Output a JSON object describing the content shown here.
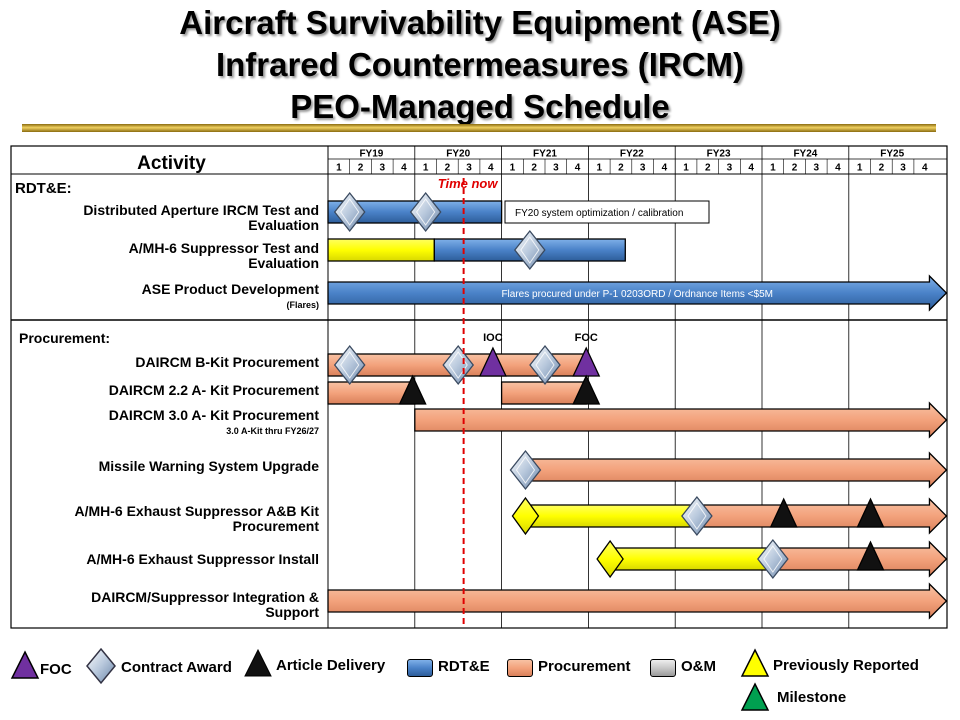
{
  "title": {
    "line1": "Aircraft Survivability Equipment (ASE)",
    "line2": "Infrared Countermeasures (IRCM)",
    "line3": "PEO-Managed Schedule"
  },
  "header": {
    "activity_label": "Activity",
    "fiscal_years": [
      "FY19",
      "FY20",
      "FY21",
      "FY22",
      "FY23",
      "FY24",
      "FY25"
    ],
    "quarters": [
      "1",
      "2",
      "3",
      "4"
    ]
  },
  "time_now_label": "Time now",
  "time_now_quarter": 6.25,
  "colors": {
    "rdte": "#4a82c8",
    "procurement": "#f3a27c",
    "om": "#c8c8c8",
    "previously_reported": "#ffff00",
    "foc": "#7030a0",
    "milestone": "#00a050",
    "time_now": "#e00000"
  },
  "sections": [
    {
      "label": "RDT&E:",
      "activities": [
        {
          "name": [
            "Distributed Aperture IRCM Test and",
            "Evaluation"
          ],
          "bars": [
            {
              "type": "rdte",
              "start": 0,
              "end": 8
            }
          ],
          "callout": "FY20 system optimization / calibration",
          "markers": [
            {
              "type": "contract-award",
              "q": 1
            },
            {
              "type": "contract-award",
              "q": 4.5
            }
          ]
        },
        {
          "name": [
            "A/MH-6 Suppressor Test and",
            "Evaluation"
          ],
          "bars": [
            {
              "type": "previously-reported",
              "start": 0,
              "end": 4.9
            },
            {
              "type": "rdte",
              "start": 4.9,
              "end": 13.7
            }
          ],
          "markers": [
            {
              "type": "contract-award",
              "q": 9.3
            }
          ]
        },
        {
          "name": [
            "ASE Product Development"
          ],
          "sub": "(Flares)",
          "bars": [
            {
              "type": "rdte",
              "start": 0,
              "end": 28.5,
              "arrow": true
            }
          ],
          "bar_text": "Flares procured under P-1 0203ORD / Ordnance Items <$5M",
          "markers": []
        }
      ]
    },
    {
      "label": "Procurement:",
      "activities": [
        {
          "name": [
            "DAIRCM B-Kit Procurement"
          ],
          "bars": [
            {
              "type": "procurement",
              "start": 0,
              "end": 12
            }
          ],
          "markers": [
            {
              "type": "contract-award",
              "q": 1
            },
            {
              "type": "contract-award",
              "q": 6
            },
            {
              "type": "foc",
              "q": 7.6,
              "label": "IOC"
            },
            {
              "type": "contract-award",
              "q": 10
            },
            {
              "type": "foc",
              "q": 11.9,
              "label": "FOC"
            }
          ]
        },
        {
          "name": [
            "DAIRCM 2.2 A- Kit Procurement"
          ],
          "bars": [
            {
              "type": "procurement",
              "start": 0,
              "end": 4
            },
            {
              "type": "procurement",
              "start": 8,
              "end": 11.9
            }
          ],
          "markers": [
            {
              "type": "delivery",
              "q": 3.9
            },
            {
              "type": "delivery",
              "q": 11.9
            }
          ]
        },
        {
          "name": [
            "DAIRCM 3.0 A- Kit Procurement"
          ],
          "sub": "3.0 A-Kit thru FY26/27",
          "bars": [
            {
              "type": "procurement",
              "start": 4,
              "end": 28.5,
              "arrow": true
            }
          ],
          "markers": []
        },
        {
          "name": [
            "Missile Warning System Upgrade"
          ],
          "bars": [
            {
              "type": "procurement",
              "start": 9,
              "end": 28.5,
              "arrow": true
            }
          ],
          "markers": [
            {
              "type": "contract-award",
              "q": 9.1
            }
          ]
        },
        {
          "name": [
            "A/MH-6 Exhaust Suppressor A&B Kit",
            "Procurement"
          ],
          "bars": [
            {
              "type": "previously-reported",
              "start": 9,
              "end": 17
            },
            {
              "type": "procurement",
              "start": 17,
              "end": 28.5,
              "arrow": true
            }
          ],
          "markers": [
            {
              "type": "previously-reported",
              "q": 9.1
            },
            {
              "type": "contract-award",
              "q": 17
            },
            {
              "type": "delivery",
              "q": 21
            },
            {
              "type": "delivery",
              "q": 25
            }
          ]
        },
        {
          "name": [
            "A/MH-6 Exhaust Suppressor Install"
          ],
          "bars": [
            {
              "type": "previously-reported",
              "start": 13,
              "end": 20.5
            },
            {
              "type": "procurement",
              "start": 20.5,
              "end": 28.5,
              "arrow": true
            }
          ],
          "markers": [
            {
              "type": "previously-reported",
              "q": 13
            },
            {
              "type": "contract-award",
              "q": 20.5
            },
            {
              "type": "delivery",
              "q": 25
            }
          ]
        },
        {
          "name": [
            "DAIRCM/Suppressor Integration &",
            "Support"
          ],
          "bars": [
            {
              "type": "procurement",
              "start": 0,
              "end": 28.5,
              "arrow": true
            }
          ],
          "markers": []
        }
      ]
    }
  ],
  "legend": {
    "foc": "FOC",
    "contract_award": "Contract Award",
    "article_delivery": "Article Delivery",
    "rdte": "RDT&E",
    "procurement": "Procurement",
    "om": "O&M",
    "previously_reported": "Previously Reported",
    "milestone": "Milestone"
  }
}
